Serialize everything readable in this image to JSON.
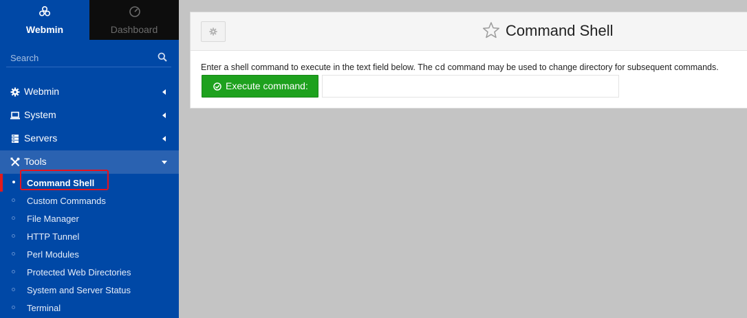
{
  "sidebar": {
    "brand": {
      "webmin_label": "Webmin",
      "dashboard_label": "Dashboard"
    },
    "search": {
      "placeholder": "Search"
    },
    "items": [
      {
        "label": "Webmin",
        "icon": "gear-icon"
      },
      {
        "label": "System",
        "icon": "laptop-icon"
      },
      {
        "label": "Servers",
        "icon": "server-icon"
      },
      {
        "label": "Tools",
        "icon": "tools-icon"
      }
    ],
    "tools_subitems": [
      "Command Shell",
      "Custom Commands",
      "File Manager",
      "HTTP Tunnel",
      "Perl Modules",
      "Protected Web Directories",
      "System and Server Status",
      "Terminal"
    ],
    "current_subitem": "Command Shell"
  },
  "main": {
    "title": "Command Shell",
    "description_before": "Enter a shell command to execute in the text field below. The ",
    "description_code": "cd",
    "description_after": " command may be used to change directory for subsequent commands.",
    "execute_button_label": "Execute command:",
    "command_input_value": ""
  },
  "colors": {
    "sidebar_bg": "#0048a6",
    "execute_button": "#1ea11e",
    "highlight": "#e8111d"
  }
}
